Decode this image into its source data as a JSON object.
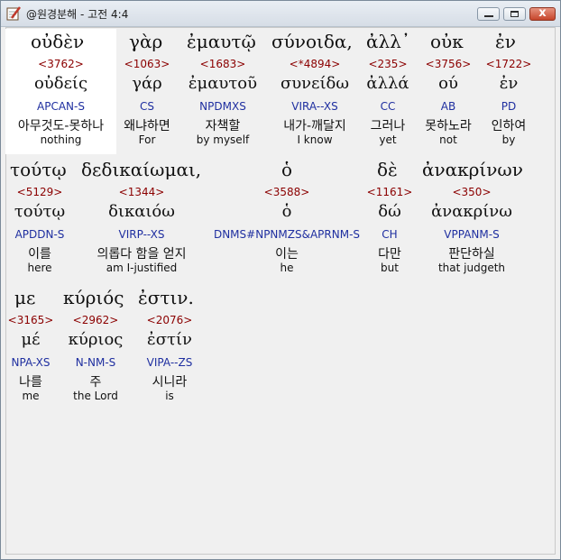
{
  "window": {
    "title": "@원경분해 - 고전 4:4",
    "icon": "pen-notepad-icon",
    "controls": {
      "minimize": "minimize-icon",
      "maximize": "maximize-icon",
      "close_label": "x"
    }
  },
  "rows": [
    {
      "greek": [
        "οὐδὲν",
        "γὰρ",
        "ἐμαυτῷ",
        "σύνοιδα,",
        "ἀλλ᾽",
        "οὐκ",
        "ἐν"
      ],
      "words": [
        {
          "strong": "<3762>",
          "lemma": "οὐδείς",
          "parse": "APCAN-S",
          "korean": "아무것도-못하나",
          "english": "nothing"
        },
        {
          "strong": "<1063>",
          "lemma": "γάρ",
          "parse": "CS",
          "korean": "왜냐하면",
          "english": "For"
        },
        {
          "strong": "<1683>",
          "lemma": "ἐμαυτοῦ",
          "parse": "NPDMXS",
          "korean": "자책할",
          "english": "by myself"
        },
        {
          "strong": "<*4894>",
          "lemma": "συνείδω",
          "parse": "VIRA--XS",
          "korean": "내가-깨달지",
          "english": "I know"
        },
        {
          "strong": "<235>",
          "lemma": "ἀλλά",
          "parse": "CC",
          "korean": "그러나",
          "english": "yet"
        },
        {
          "strong": "<3756>",
          "lemma": "ού",
          "parse": "AB",
          "korean": "못하노라",
          "english": "not"
        },
        {
          "strong": "<1722>",
          "lemma": "ἐν",
          "parse": "PD",
          "korean": "인하여",
          "english": "by"
        }
      ]
    },
    {
      "greek": [
        "τούτῳ",
        "δεδικαίωμαι,",
        "ὁ",
        "δὲ",
        "ἀνακρίνων"
      ],
      "words": [
        {
          "strong": "<5129>",
          "lemma": "τούτῳ",
          "parse": "APDDN-S",
          "korean": "이를",
          "english": "here"
        },
        {
          "strong": "<1344>",
          "lemma": "δικαιόω",
          "parse": "VIRP--XS",
          "korean": "의롭다 함을 얻지",
          "english": "am I-justified"
        },
        {
          "strong": "<3588>",
          "lemma": "ὁ",
          "parse": "DNMS#NPNMZS&APRNM-S",
          "korean": "이는",
          "english": "he"
        },
        {
          "strong": "<1161>",
          "lemma": "δώ",
          "parse": "CH",
          "korean": "다만",
          "english": "but"
        },
        {
          "strong": "<350>",
          "lemma": "ἀνακρίνω",
          "parse": "VPPANM-S",
          "korean": "판단하실",
          "english": "that judgeth"
        }
      ]
    },
    {
      "greek": [
        "με",
        "κύριός",
        "ἐστιν."
      ],
      "words": [
        {
          "strong": "<3165>",
          "lemma": "μέ",
          "parse": "NPA-XS",
          "korean": "나를",
          "english": "me"
        },
        {
          "strong": "<2962>",
          "lemma": "κύριος",
          "parse": "N-NM-S",
          "korean": "주",
          "english": "the Lord"
        },
        {
          "strong": "<2076>",
          "lemma": "ἐστίν",
          "parse": "VIPA--ZS",
          "korean": "시니라",
          "english": "is"
        }
      ]
    }
  ]
}
